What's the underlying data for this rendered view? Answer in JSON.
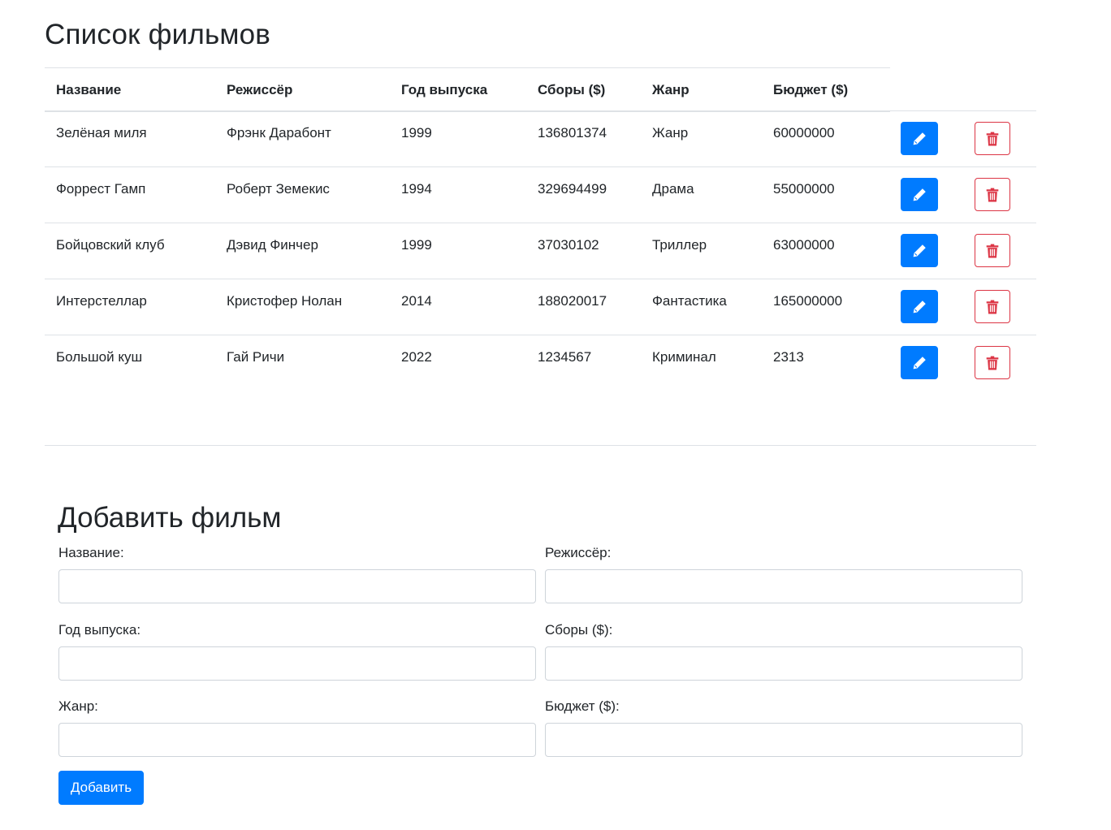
{
  "page": {
    "title": "Список фильмов"
  },
  "table": {
    "headers": [
      "Название",
      "Режиссёр",
      "Год выпуска",
      "Сборы ($)",
      "Жанр",
      "Бюджет ($)"
    ],
    "rows": [
      {
        "title": "Зелёная миля",
        "director": "Фрэнк Дарабонт",
        "year": "1999",
        "gross": "136801374",
        "genre": "Жанр",
        "budget": "60000000"
      },
      {
        "title": "Форрест Гамп",
        "director": "Роберт Земекис",
        "year": "1994",
        "gross": "329694499",
        "genre": "Драма",
        "budget": "55000000"
      },
      {
        "title": "Бойцовский клуб",
        "director": "Дэвид Финчер",
        "year": "1999",
        "gross": "37030102",
        "genre": "Триллер",
        "budget": "63000000"
      },
      {
        "title": "Интерстеллар",
        "director": "Кристофер Нолан",
        "year": "2014",
        "gross": "188020017",
        "genre": "Фантастика",
        "budget": "165000000"
      },
      {
        "title": "Большой куш",
        "director": "Гай Ричи",
        "year": "2022",
        "gross": "1234567",
        "genre": "Криминал",
        "budget": "2313"
      }
    ],
    "edit_icon": "pencil-icon",
    "delete_icon": "trash-icon"
  },
  "form": {
    "title": "Добавить фильм",
    "fields": {
      "title": {
        "label": "Название:",
        "value": ""
      },
      "director": {
        "label": "Режиссёр:",
        "value": ""
      },
      "year": {
        "label": "Год выпуска:",
        "value": ""
      },
      "gross": {
        "label": "Сборы ($):",
        "value": ""
      },
      "genre": {
        "label": "Жанр:",
        "value": ""
      },
      "budget": {
        "label": "Бюджет ($):",
        "value": ""
      }
    },
    "submit_label": "Добавить"
  },
  "colors": {
    "primary": "#007bff",
    "danger": "#dc3545",
    "border": "#dee2e6"
  }
}
